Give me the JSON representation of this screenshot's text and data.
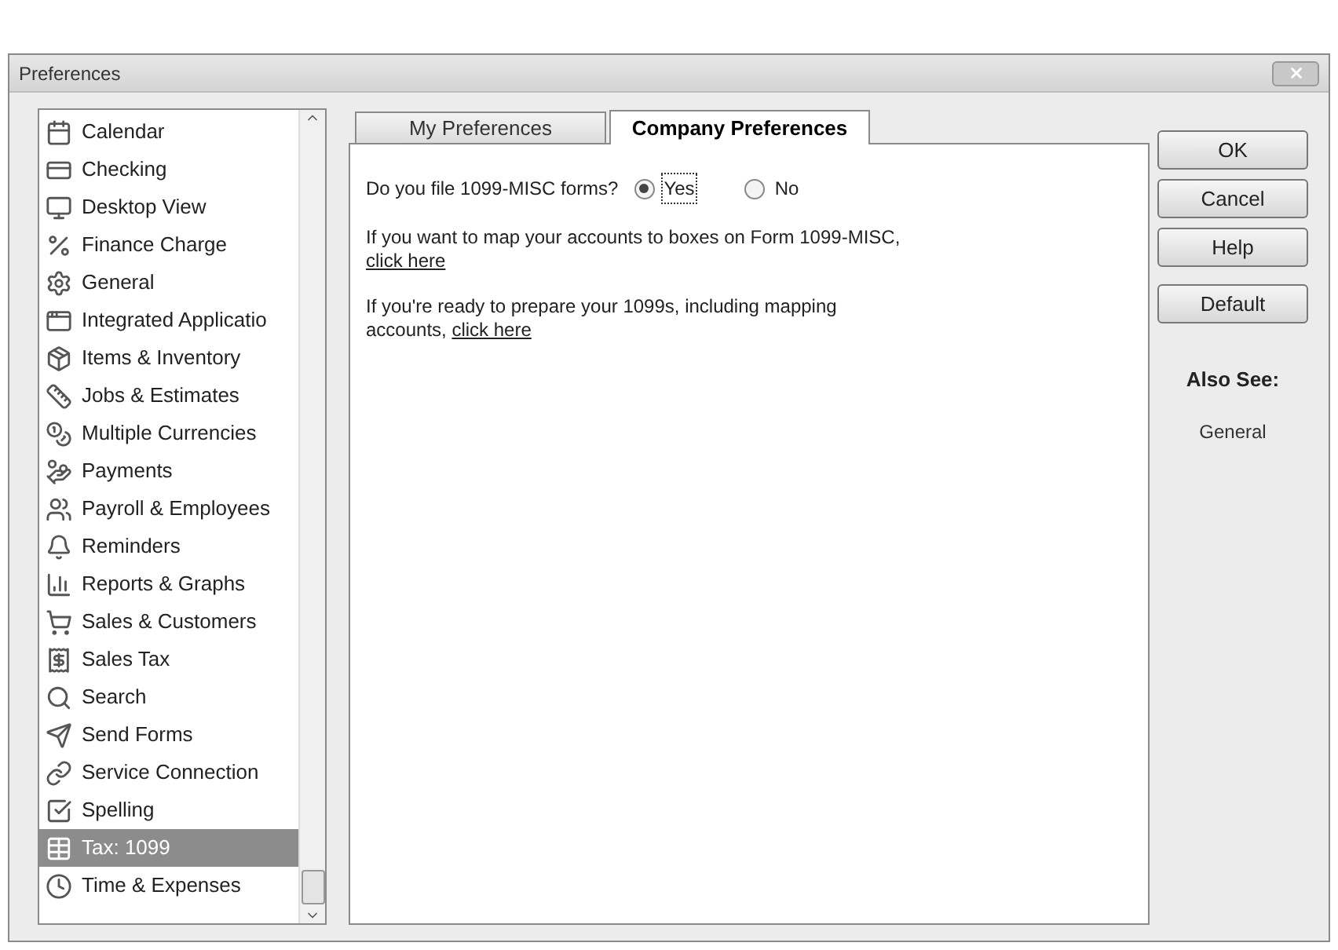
{
  "window": {
    "title": "Preferences"
  },
  "sidebar": {
    "items": [
      {
        "label": "Calendar",
        "selected": false
      },
      {
        "label": "Checking",
        "selected": false
      },
      {
        "label": "Desktop View",
        "selected": false
      },
      {
        "label": "Finance Charge",
        "selected": false
      },
      {
        "label": "General",
        "selected": false
      },
      {
        "label": "Integrated Applicatio",
        "selected": false
      },
      {
        "label": "Items & Inventory",
        "selected": false
      },
      {
        "label": "Jobs & Estimates",
        "selected": false
      },
      {
        "label": "Multiple Currencies",
        "selected": false
      },
      {
        "label": "Payments",
        "selected": false
      },
      {
        "label": "Payroll & Employees",
        "selected": false
      },
      {
        "label": "Reminders",
        "selected": false
      },
      {
        "label": "Reports & Graphs",
        "selected": false
      },
      {
        "label": "Sales & Customers",
        "selected": false
      },
      {
        "label": "Sales Tax",
        "selected": false
      },
      {
        "label": "Search",
        "selected": false
      },
      {
        "label": "Send Forms",
        "selected": false
      },
      {
        "label": "Service Connection",
        "selected": false
      },
      {
        "label": "Spelling",
        "selected": false
      },
      {
        "label": "Tax: 1099",
        "selected": true
      },
      {
        "label": "Time & Expenses",
        "selected": false
      }
    ]
  },
  "tabs": [
    {
      "label": "My Preferences",
      "selected": false
    },
    {
      "label": "Company Preferences",
      "selected": true
    }
  ],
  "panel": {
    "question": "Do you file 1099-MISC forms?",
    "options": [
      {
        "label": "Yes",
        "selected": true
      },
      {
        "label": "No",
        "selected": false
      }
    ],
    "paragraphs": [
      {
        "text": "If you want to map your accounts to boxes on Form 1099-MISC,",
        "link": "click here"
      },
      {
        "text": "If you're ready to prepare your 1099s, including mapping accounts,",
        "link": "click here"
      }
    ]
  },
  "buttons": [
    "OK",
    "Cancel",
    "Help",
    "Default"
  ],
  "also_see": {
    "title": "Also See:",
    "links": [
      "General"
    ]
  }
}
